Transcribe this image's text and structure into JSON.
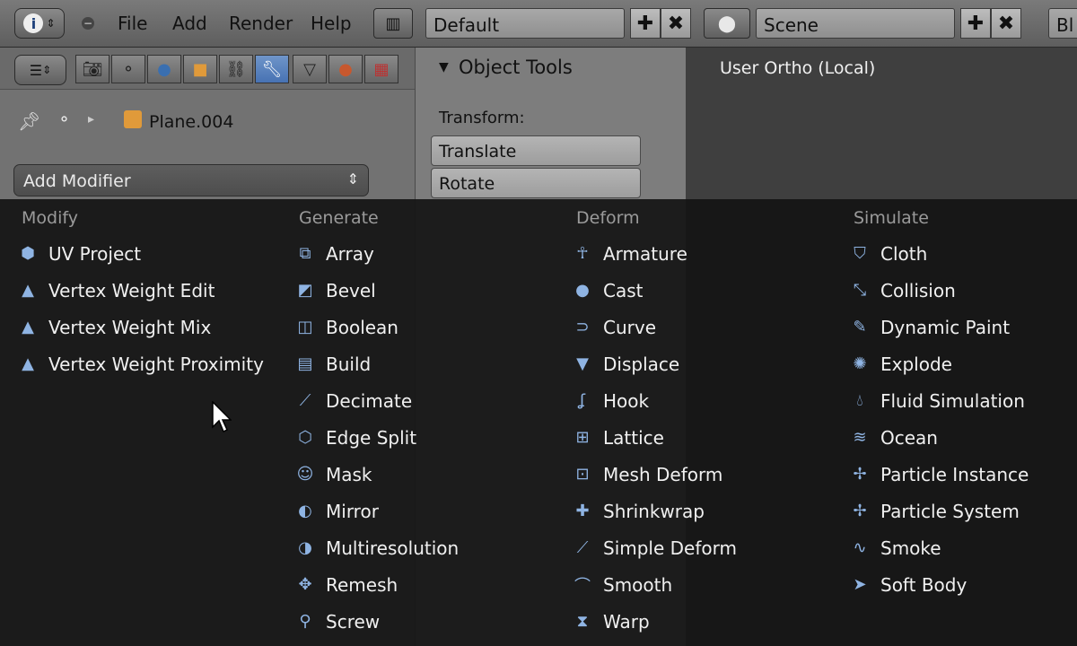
{
  "topbar": {
    "menus": [
      "File",
      "Add",
      "Render",
      "Help"
    ],
    "layout_field": "Default",
    "scene_field": "Scene",
    "right_cut": "Bl"
  },
  "properties": {
    "object_name": "Plane.004",
    "add_modifier_label": "Add Modifier"
  },
  "toolshelf": {
    "panel_title": "Object Tools",
    "transform_label": "Transform:",
    "buttons": [
      "Translate",
      "Rotate"
    ]
  },
  "viewport": {
    "label": "User Ortho (Local)"
  },
  "modifier_menu": {
    "columns": [
      {
        "heading": "Modify",
        "items": [
          "UV Project",
          "Vertex Weight Edit",
          "Vertex Weight Mix",
          "Vertex Weight Proximity"
        ]
      },
      {
        "heading": "Generate",
        "items": [
          "Array",
          "Bevel",
          "Boolean",
          "Build",
          "Decimate",
          "Edge Split",
          "Mask",
          "Mirror",
          "Multiresolution",
          "Remesh",
          "Screw"
        ]
      },
      {
        "heading": "Deform",
        "items": [
          "Armature",
          "Cast",
          "Curve",
          "Displace",
          "Hook",
          "Lattice",
          "Mesh Deform",
          "Shrinkwrap",
          "Simple Deform",
          "Smooth",
          "Warp"
        ]
      },
      {
        "heading": "Simulate",
        "items": [
          "Cloth",
          "Collision",
          "Dynamic Paint",
          "Explode",
          "Fluid Simulation",
          "Ocean",
          "Particle Instance",
          "Particle System",
          "Smoke",
          "Soft Body"
        ]
      }
    ]
  },
  "colors": {
    "active_tab": "#4772b3",
    "menu_bg": "#141414",
    "icon_blue": "#8fb4e3"
  }
}
